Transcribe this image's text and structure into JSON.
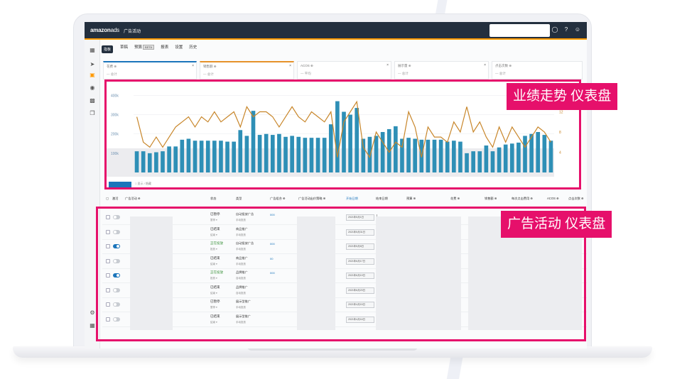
{
  "app": {
    "logo_main": "amazon",
    "logo_sub": "ads",
    "page_title": "广告活动",
    "tooltip": "指板"
  },
  "icons": {
    "top": [
      "bell-icon",
      "help-icon",
      "user-icon"
    ],
    "rail": [
      "dashboard-icon",
      "rocket-icon",
      "campaign-icon",
      "shield-icon",
      "chart-icon",
      "copy-icon",
      "settings-icon",
      "grid-icon"
    ]
  },
  "tabs": [
    {
      "label": "草稿"
    },
    {
      "label": "预算",
      "badge": "BETA"
    },
    {
      "label": "报表"
    },
    {
      "label": "设置"
    },
    {
      "label": "历史"
    }
  ],
  "metrics": [
    {
      "label": "花费 ⊕",
      "value": "— 总计",
      "close": "×"
    },
    {
      "label": "销售额 ⊕",
      "value": "— 总计",
      "close": "×"
    },
    {
      "label": "ACOS ⊕",
      "value": "— 平均",
      "close": "×"
    },
    {
      "label": "展示量 ⊕",
      "value": "— 总计",
      "close": "×"
    },
    {
      "label": "点击次数 ⊕",
      "value": "— 总计",
      "close": "×"
    }
  ],
  "chart_data": {
    "type": "bar",
    "title": "",
    "y_ticks": [
      "400k",
      "300k",
      "200k",
      "100k"
    ],
    "y2_ticks": [
      "12",
      "8",
      "4"
    ],
    "ylim": [
      0,
      420000
    ],
    "y2lim": [
      0,
      16
    ],
    "grid": true,
    "series": [
      {
        "color": "#2e8fb6",
        "values": [
          110000,
          110000,
          100000,
          105000,
          110000,
          135000,
          135000,
          170000,
          175000,
          165000,
          165000,
          165000,
          165000,
          165000,
          160000,
          160000,
          220000,
          190000,
          320000,
          195000,
          200000,
          195000,
          200000,
          185000,
          190000,
          185000,
          180000,
          180000,
          180000,
          180000,
          250000,
          370000,
          315000,
          300000,
          335000,
          175000,
          185000,
          190000,
          210000,
          225000,
          240000,
          175000,
          180000,
          175000,
          170000,
          170000,
          170000,
          170000,
          160000,
          165000,
          160000,
          100000,
          110000,
          110000,
          140000,
          110000,
          130000,
          145000,
          150000,
          155000,
          190000,
          200000,
          210000,
          195000,
          165000
        ]
      },
      {
        "color": "#c8862a",
        "values": [
          11,
          6,
          5,
          7,
          5,
          7,
          9,
          10,
          11,
          9,
          11,
          10,
          12,
          10,
          11,
          12,
          9,
          13,
          11,
          12,
          12,
          11,
          9,
          11,
          13,
          11,
          10,
          12,
          11,
          10,
          12,
          3,
          10,
          12,
          14,
          5,
          3,
          8,
          6,
          4,
          6,
          5,
          12,
          9,
          3,
          9,
          7,
          7,
          6,
          10,
          8,
          13,
          8,
          10,
          7,
          5,
          9,
          6,
          9,
          7,
          5,
          7,
          9,
          8,
          6
        ]
      }
    ]
  },
  "chart_footer": {
    "button": "",
    "label": "□ 显示 / 隐藏"
  },
  "table": {
    "headers": [
      "激活",
      "广告活动 ⊕",
      "状态",
      "类型",
      "广告组合 ⊕",
      "广告活动出价策略 ⊕",
      "开始日期",
      "结束日期",
      "预算 ⊕",
      "花费 ⊕",
      "销售额 ⊕",
      "每次点击费用 ⊕",
      "ACOS ⊕",
      "点击次数 ⊕"
    ],
    "rows": [
      {
        "on": false,
        "status": "已暂停",
        "status_sub": "暂停 ▾",
        "type": "自动投放广告",
        "type_sub": "手动投放",
        "bid": "000",
        "date": "2021年5月1日"
      },
      {
        "on": false,
        "status": "已结束",
        "status_sub": "结束 ▾",
        "type": "商品推广",
        "type_sub": "手动投放",
        "bid": "",
        "date": "2021年5月31日"
      },
      {
        "on": true,
        "status": "正在投放",
        "status_sub": "投放 ▾",
        "type": "自动投放广告",
        "type_sub": "手动投放",
        "bid": "000",
        "date": "2021年5月6日"
      },
      {
        "on": false,
        "status": "已结束",
        "status_sub": "结束 ▾",
        "type": "商品推广",
        "type_sub": "手动投放",
        "bid": "00",
        "date": "2021年6月17日"
      },
      {
        "on": true,
        "status": "正在投放",
        "status_sub": "投放 ▾",
        "type": "品牌推广",
        "type_sub": "自动投放",
        "bid": "000",
        "date": "2021年6月19日"
      },
      {
        "on": false,
        "status": "已结束",
        "status_sub": "结束 ▾",
        "type": "品牌推广",
        "type_sub": "自动投放",
        "bid": "",
        "date": "2021年6月23日"
      },
      {
        "on": false,
        "status": "已暂停",
        "status_sub": "暂停 ▾",
        "type": "展示型推广",
        "type_sub": "手动投放",
        "bid": "",
        "date": "2021年4月15日"
      },
      {
        "on": false,
        "status": "已结束",
        "status_sub": "结束 ▾",
        "type": "展示型推广",
        "type_sub": "手动投放",
        "bid": "",
        "date": "2021年4月16日"
      }
    ]
  },
  "annotations": {
    "chart_label": "业绩走势 仪表盘",
    "table_label": "广告活动 仪表盘",
    "accent": "#e6106b"
  }
}
